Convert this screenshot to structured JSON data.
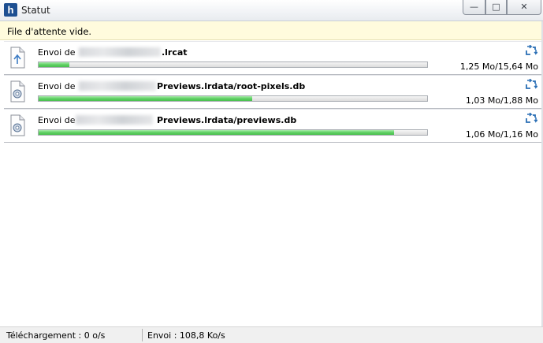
{
  "window": {
    "title": "Statut",
    "app_icon_letter": "h",
    "controls": {
      "minimize": "—",
      "maximize": "□",
      "close": "✕"
    }
  },
  "notice": "File d'attente vide.",
  "uploads": [
    {
      "prefix": "Envoi de",
      "filename": ".lrcat",
      "size_text": "1,25 Mo/15,64 Mo",
      "progress": 0.08,
      "icon": "document-icon"
    },
    {
      "prefix": "Envoi de",
      "filename": "Previews.lrdata/root-pixels.db",
      "size_text": "1,03 Mo/1,88 Mo",
      "progress": 0.55,
      "icon": "database-file-icon"
    },
    {
      "prefix": "Envoi de",
      "filename": "Previews.lrdata/previews.db",
      "size_text": "1,06 Mo/1,16 Mo",
      "progress": 0.914,
      "icon": "database-file-icon"
    }
  ],
  "statusbar": {
    "download": "Téléchargement : 0 o/s",
    "upload": "Envoi : 108,8 Ko/s"
  },
  "colors": {
    "progress_fill": "#5fd063",
    "notice_bg": "#fffbdd",
    "sync_icon": "#2a6fb5"
  }
}
